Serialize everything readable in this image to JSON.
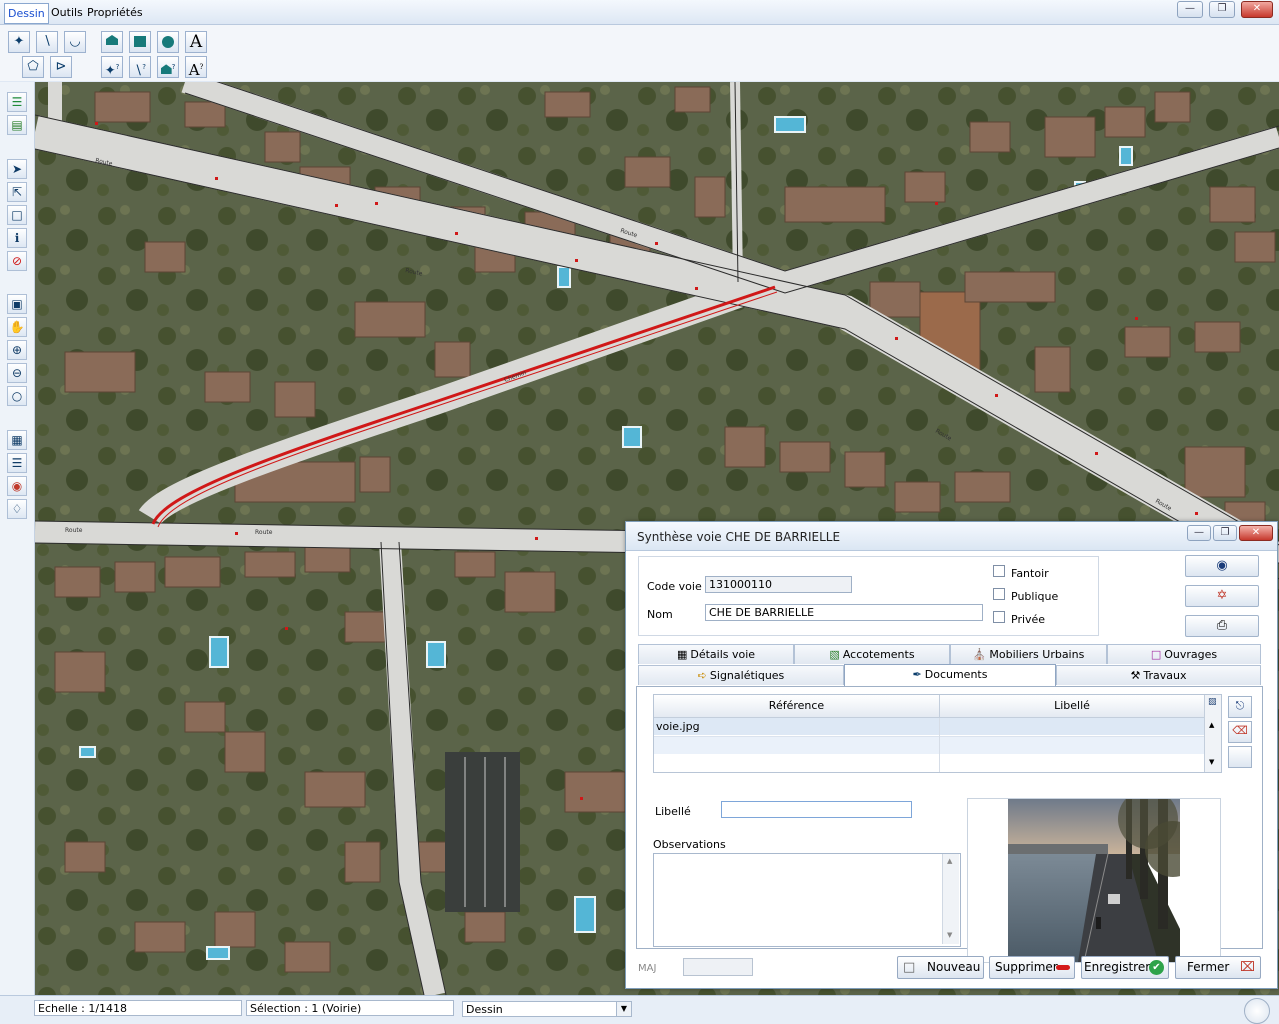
{
  "menubar": {
    "items": [
      "Dessin",
      "Outils",
      "Propriétés"
    ],
    "window_buttons": [
      "minimize",
      "restore",
      "close"
    ]
  },
  "toolbar": {
    "row1": [
      "select-arrow-icon",
      "line-icon",
      "polyline-icon",
      "polygon-icon",
      "rectangle-icon",
      "circle-icon",
      "text-icon"
    ],
    "row2": [
      "polygon-edit-icon",
      "node-icon",
      "select-question-icon",
      "line-question-icon",
      "polygon-question-icon",
      "text-question-icon"
    ],
    "text_tool_label": "A"
  },
  "leftbar": {
    "tools": [
      "layers-icon",
      "layer-stack-icon",
      "pointer-icon",
      "select-point-icon",
      "select-rect-icon",
      "select-info-icon",
      "no-entry-icon",
      "zoom-window-icon",
      "pan-hand-icon",
      "zoom-in-icon",
      "zoom-out-icon",
      "zoom-full-icon",
      "report-icon",
      "list-icon",
      "color-wheel-icon",
      "objects-icon"
    ]
  },
  "map": {
    "road_labels": [
      "Route",
      "Route",
      "Route",
      "Chemin",
      "Route",
      "Route",
      "Route",
      "Route"
    ]
  },
  "statusbar": {
    "scale": "Echelle : 1/1418",
    "selection": "Sélection : 1 (Voirie)",
    "mode": "Dessin"
  },
  "dialog": {
    "title": "Synthèse voie CHE DE BARRIELLE",
    "code_voie_label": "Code voie",
    "code_voie_value": "131000110",
    "nom_label": "Nom",
    "nom_value": "CHE DE BARRIELLE",
    "checkboxes": [
      {
        "label": "Fantoir",
        "checked": false
      },
      {
        "label": "Publique",
        "checked": false
      },
      {
        "label": "Privée",
        "checked": false
      }
    ],
    "tabs_row1": [
      "Détails voie",
      "Accotements",
      "Mobiliers Urbains",
      "Ouvrages"
    ],
    "tabs_row2": [
      "Signalétiques",
      "Documents",
      "Travaux"
    ],
    "active_tab": "Documents",
    "table": {
      "columns": [
        "Référence",
        "Libellé"
      ],
      "rows": [
        [
          "voie.jpg",
          ""
        ]
      ]
    },
    "libelle_label": "Libellé",
    "libelle_value": "",
    "observations_label": "Observations",
    "observations_value": "",
    "maj_label": "MAJ",
    "buttons": {
      "nouveau": "Nouveau",
      "supprimer": "Supprimer",
      "enregistrer": "Enregistrer",
      "fermer": "Fermer"
    }
  },
  "colors": {
    "road": "#d9d9d6",
    "selected_road": "#d01818",
    "map_background": "#5d6650",
    "accent": "#1a4fd1"
  }
}
